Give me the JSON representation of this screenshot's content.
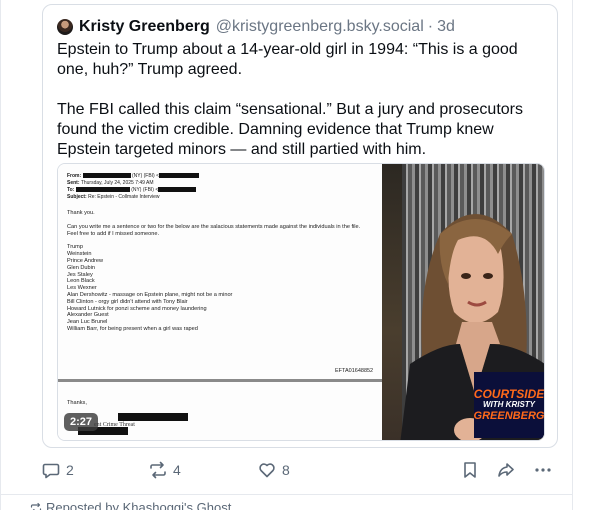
{
  "quoted_post": {
    "author_name": "Kristy Greenberg",
    "author_handle": "@kristygreenberg.bsky.social",
    "separator": "·",
    "time_ago": "3d",
    "paragraphs": [
      "Epstein to Trump about a 14-year-old girl in 1994: “This is a good one, huh?” Trump agreed.",
      "The FBI called this claim “sensational.” But a jury and prosecutors found the victim credible. Damning evidence that Trump knew Epstein targeted minors — and still partied with him."
    ]
  },
  "embed": {
    "email": {
      "from_label": "From:",
      "from_value": "(NY) (FBI) <",
      "sent_label": "Sent:",
      "sent_value": "Thursday, July 24, 2025 7:49 AM",
      "to_label": "To:",
      "to_value": "(NY) (FBI) <",
      "subject_label": "Subject:",
      "subject_value": "Re: Epstein - Collmate Interview",
      "greeting": "Thank you.",
      "request": "Can you write me a sentence or two for the below are the salacious statements made against the individuals in the file. Feel free to add if I missed someone.",
      "names": [
        "Trump",
        "Weinstein",
        "Prince Andrew",
        "Glen Dubin",
        "Jes Staley",
        "Leon Black",
        "Les Wexner",
        "Alan Dershowitz - massage on Epstein plane, might not be a minor",
        "Bill Clinton - orgy girl didn't attend with Tony Blair",
        "Howard Lutnick for ponzi scheme and money laundering",
        "Alexander Guest",
        "Jean Luc Brunel",
        "William Barr, for being present when a girl was raped"
      ],
      "doc_code": "EFTA01648852",
      "closing": "Thanks,",
      "signature_fragment": "ent Crime Threat"
    },
    "duration": "2:27",
    "video_logo": {
      "line1": "COURTSIDE",
      "line2": "WITH KRISTY",
      "line3": "GREENBERG"
    }
  },
  "actions": {
    "reply_count": "2",
    "repost_count": "4",
    "like_count": "8",
    "bookmark_icon": "bookmark-icon",
    "share_icon": "share-icon",
    "more_icon": "more-icon"
  },
  "next_post": {
    "repost_text": "Reposted by Khashoggi's Ghost"
  },
  "colors": {
    "text": "#0b0f14",
    "muted": "#6b7684",
    "border": "#d9dee5",
    "logo_bg": "#0b0f3a",
    "logo_accent": "#ff6a1a"
  }
}
